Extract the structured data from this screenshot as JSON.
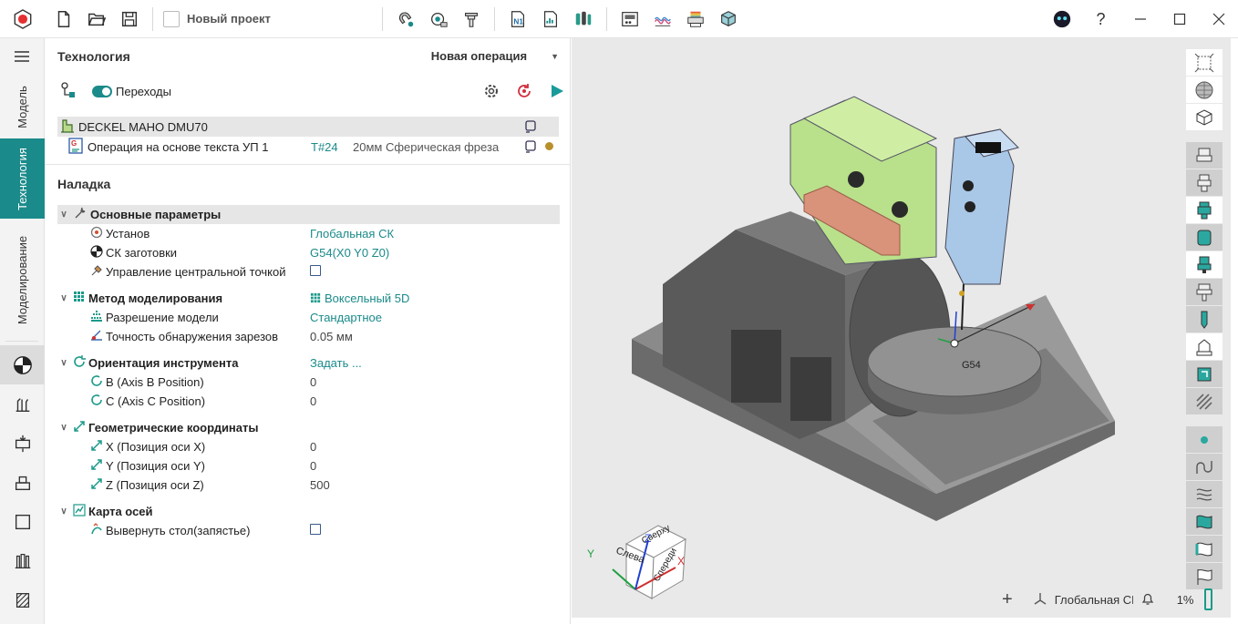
{
  "toolbar": {
    "project_name": "Новый проект"
  },
  "left_tabs": {
    "model": "Модель",
    "technology": "Технология",
    "modeling": "Моделирование"
  },
  "panel": {
    "title": "Технология",
    "new_operation": "Новая операция",
    "transitions_label": "Переходы",
    "machine": "DECKEL MAHO DMU70",
    "operation": {
      "name": "Операция на основе текста УП 1",
      "tool_num": "T#24",
      "tool_desc": "20мм Сферическая фреза"
    },
    "setup_title": "Наладка",
    "props": [
      {
        "label": "Основные параметры",
        "value": ""
      },
      {
        "label": "Установ",
        "value": "Глобальная СК"
      },
      {
        "label": "СК заготовки",
        "value": "G54(X0 Y0 Z0)"
      },
      {
        "label": "Управление центральной точкой",
        "value": ""
      },
      {
        "label": "Метод моделирования",
        "value": "Воксельный 5D"
      },
      {
        "label": "Разрешение модели",
        "value": "Стандартное"
      },
      {
        "label": "Точность обнаружения зарезов",
        "value": "0.05 мм"
      },
      {
        "label": "Ориентация инструмента",
        "value": "Задать ..."
      },
      {
        "label": "B (Axis B Position)",
        "value": "0"
      },
      {
        "label": "C (Axis C Position)",
        "value": "0"
      },
      {
        "label": "Геометрические координаты",
        "value": ""
      },
      {
        "label": "X (Позиция оси X)",
        "value": "0"
      },
      {
        "label": "Y (Позиция оси Y)",
        "value": "0"
      },
      {
        "label": "Z (Позиция оси Z)",
        "value": "500"
      },
      {
        "label": "Карта осей",
        "value": ""
      },
      {
        "label": "Вывернуть стол(запястье)",
        "value": ""
      }
    ]
  },
  "viewport": {
    "g54_label": "G54",
    "cube": {
      "top": "Сверху",
      "left": "Слева",
      "front": "Спереди",
      "z": "Z",
      "y": "Y",
      "x": "X"
    },
    "status_cs": "Глобальная СК",
    "zoom": "1%"
  },
  "colors": {
    "accent": "#1b8a8a",
    "green_block": "#b9e08a",
    "blue_block": "#a9c7e6",
    "copper": "#d9937a",
    "machine_gray": "#7a7a7a"
  }
}
